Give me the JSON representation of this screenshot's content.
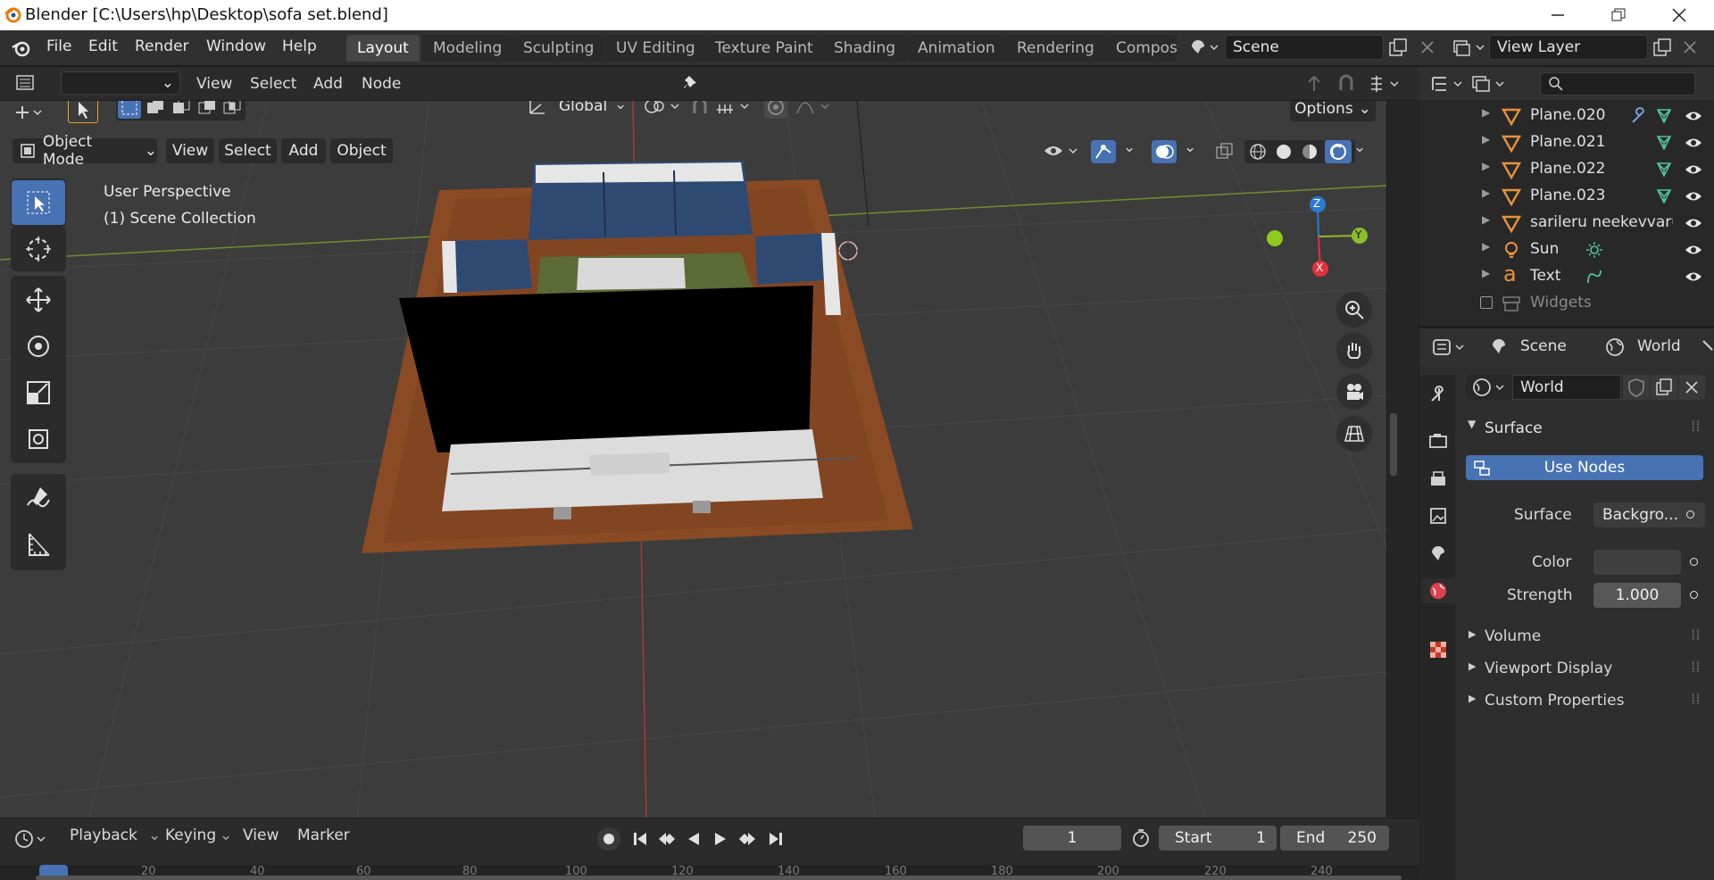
{
  "window": {
    "title": "Blender [C:\\Users\\hp\\Desktop\\sofa set.blend]"
  },
  "menus": [
    "File",
    "Edit",
    "Render",
    "Window",
    "Help"
  ],
  "workspaces": [
    "Layout",
    "Modeling",
    "Sculpting",
    "UV Editing",
    "Texture Paint",
    "Shading",
    "Animation",
    "Rendering",
    "Compos"
  ],
  "scene_field": "Scene",
  "view_layer_field": "View Layer",
  "editor_header": {
    "view": "View",
    "select": "Select",
    "add": "Add",
    "node": "Node"
  },
  "viewport_header": {
    "mode": "Object Mode",
    "view": "View",
    "select": "Select",
    "add": "Add",
    "object": "Object",
    "transform_orientation": "Global",
    "options": "Options"
  },
  "viewport": {
    "perspective_label": "User Perspective",
    "collection_label": "(1) Scene Collection"
  },
  "gizmo": {
    "x": "X",
    "y": "Y",
    "z": "Z"
  },
  "outliner": {
    "items": [
      {
        "name": "Plane.020",
        "icon": "mesh-icon"
      },
      {
        "name": "Plane.021",
        "icon": "mesh-icon"
      },
      {
        "name": "Plane.022",
        "icon": "mesh-icon"
      },
      {
        "name": "Plane.023",
        "icon": "mesh-icon"
      },
      {
        "name": "sarileru neekevvaru",
        "icon": "mesh-icon"
      },
      {
        "name": "Sun",
        "icon": "light-icon"
      },
      {
        "name": "Text",
        "icon": "text-icon"
      },
      {
        "name": "Widgets",
        "icon": "collection-icon"
      }
    ],
    "text_icon_glyph": "a"
  },
  "properties": {
    "scene_tab": "Scene",
    "world_tab": "World",
    "world_name": "World",
    "surface_panel": "Surface",
    "use_nodes": "Use Nodes",
    "surface_label": "Surface",
    "surface_value": "Backgro...",
    "color_label": "Color",
    "strength_label": "Strength",
    "strength_value": "1.000",
    "volume": "Volume",
    "viewport_display": "Viewport Display",
    "custom_properties": "Custom Properties"
  },
  "timeline": {
    "playback": "Playback",
    "keying": "Keying",
    "view": "View",
    "marker": "Marker",
    "current_frame": "1",
    "start_label": "Start",
    "start_value": "1",
    "end_label": "End",
    "end_value": "250",
    "ruler_ticks": [
      "20",
      "40",
      "60",
      "80",
      "100",
      "120",
      "140",
      "160",
      "180",
      "200",
      "220",
      "240"
    ]
  },
  "colors": {
    "accent": "#4772b3",
    "bg": "#3c3c3c",
    "header": "#303030",
    "floor": "#8a4a24",
    "sofa": "#2f4a72"
  }
}
